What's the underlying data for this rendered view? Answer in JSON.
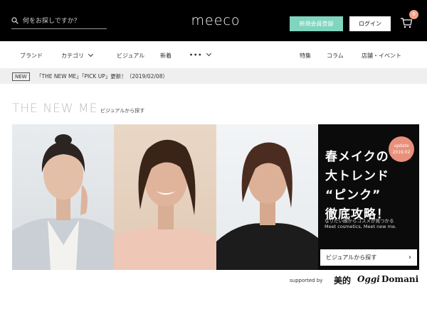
{
  "header": {
    "search_placeholder": "何をお探しですか？",
    "logo": "meeco",
    "register_label": "新規会員登録",
    "login_label": "ログイン",
    "cart_count": "0"
  },
  "nav": {
    "left": [
      {
        "label": "ブランド"
      },
      {
        "label": "カテゴリ"
      },
      {
        "label": "ビジュアル"
      },
      {
        "label": "新着"
      },
      {
        "label": "•••"
      }
    ],
    "right": [
      {
        "label": "特集"
      },
      {
        "label": "コラム"
      },
      {
        "label": "店舗・イベント"
      }
    ]
  },
  "ticker": {
    "badge": "NEW",
    "text": "「THE NEW ME」「PICK UP」更新！（2019/02/08）"
  },
  "section": {
    "title": "THE NEW ME",
    "subtitle": "ビジュアルから探す"
  },
  "promo": {
    "badge_line1": "update",
    "badge_line2": "2019.02",
    "headline_lines": [
      "春メイクの",
      "大トレンド",
      "“ピンク”",
      "徹底攻略！"
    ],
    "tagline1": "なりたい顔からコスメが見つかる",
    "tagline2": "Meet cosmetics, Meet new me.",
    "cta_label": "ビジュアルから探す",
    "cta_arrow": "›"
  },
  "footer": {
    "supported_by": "supported by",
    "sponsors": [
      "美的",
      "Oggi",
      "Domani"
    ]
  },
  "colors": {
    "accent": "#7fd5bd",
    "badge": "#f1a38a",
    "dark": "#000000"
  }
}
